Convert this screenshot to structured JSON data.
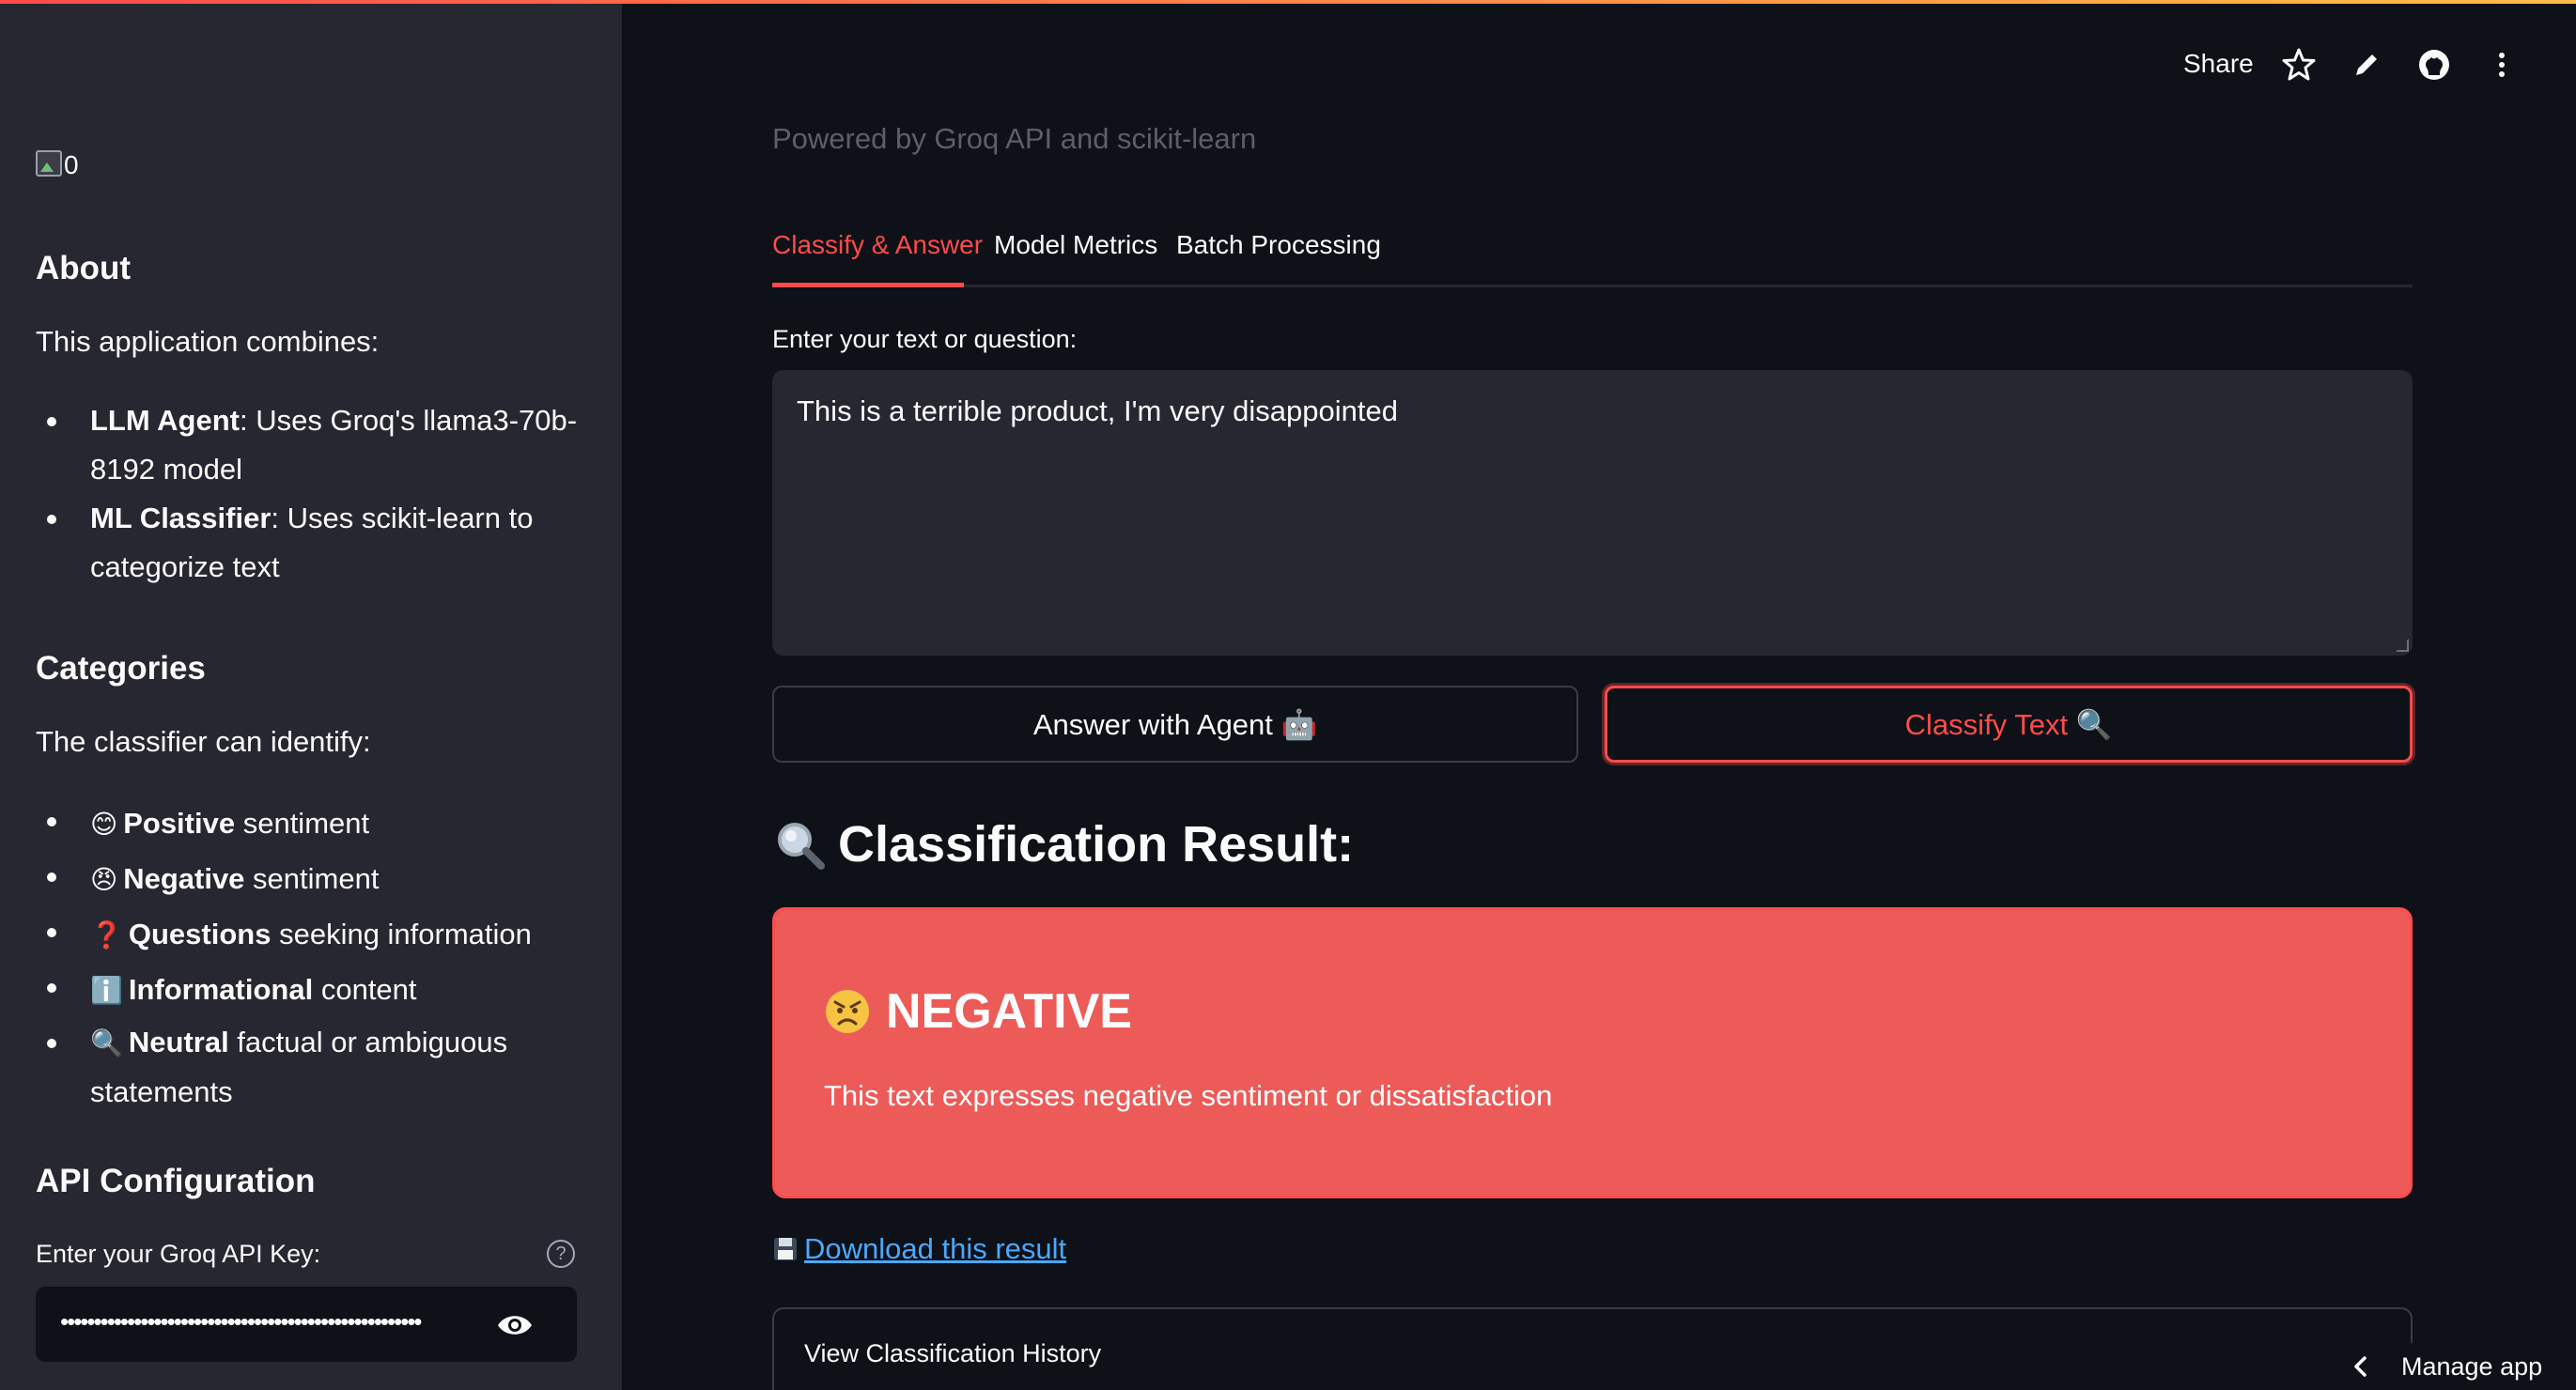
{
  "header": {
    "share_label": "Share"
  },
  "sidebar": {
    "image_alt": "0",
    "about_title": "About",
    "about_intro": "This application combines:",
    "about_items": [
      {
        "bold": "LLM Agent",
        "rest": ": Uses Groq's llama3-70b-8192 model"
      },
      {
        "bold": "ML Classifier",
        "rest": ": Uses scikit-learn to categorize text"
      }
    ],
    "categories_title": "Categories",
    "categories_intro": "The classifier can identify:",
    "categories": [
      {
        "emoji": "😊",
        "bold": "Positive",
        "rest": " sentiment"
      },
      {
        "emoji": "😠",
        "bold": "Negative",
        "rest": " sentiment"
      },
      {
        "emoji": "❓",
        "bold": "Questions",
        "rest": " seeking information"
      },
      {
        "emoji": "ℹ️",
        "bold": "Informational",
        "rest": " content"
      },
      {
        "emoji": "🔍",
        "bold": "Neutral",
        "rest": " factual or ambiguous statements"
      }
    ],
    "api_title": "API Configuration",
    "api_label": "Enter your Groq API Key:",
    "api_value": "••••••••••••••••••••••••••••••••••••••••••••••••••••••"
  },
  "main": {
    "caption": "Powered by Groq API and scikit-learn",
    "tabs": [
      {
        "label": "Classify & Answer",
        "active": true
      },
      {
        "label": "Model Metrics",
        "active": false
      },
      {
        "label": "Batch Processing",
        "active": false
      }
    ],
    "input_label": "Enter your text or question:",
    "input_value": "This is a terrible product, I'm very disappointed",
    "answer_button": "Answer with Agent 🤖",
    "classify_button": "Classify Text 🔍",
    "result_heading": "Classification Result:",
    "result_title": "NEGATIVE",
    "result_description": "This text expresses negative sentiment or dissatisfaction",
    "download_link": "Download this result",
    "history_label": "View Classification History"
  },
  "footer": {
    "manage_app": "Manage app"
  },
  "colors": {
    "accent": "#ff4b4b",
    "result_bg": "#ec5b58",
    "sidebar_bg": "#262730",
    "main_bg": "#0e1117",
    "link": "#4aa8ff"
  }
}
